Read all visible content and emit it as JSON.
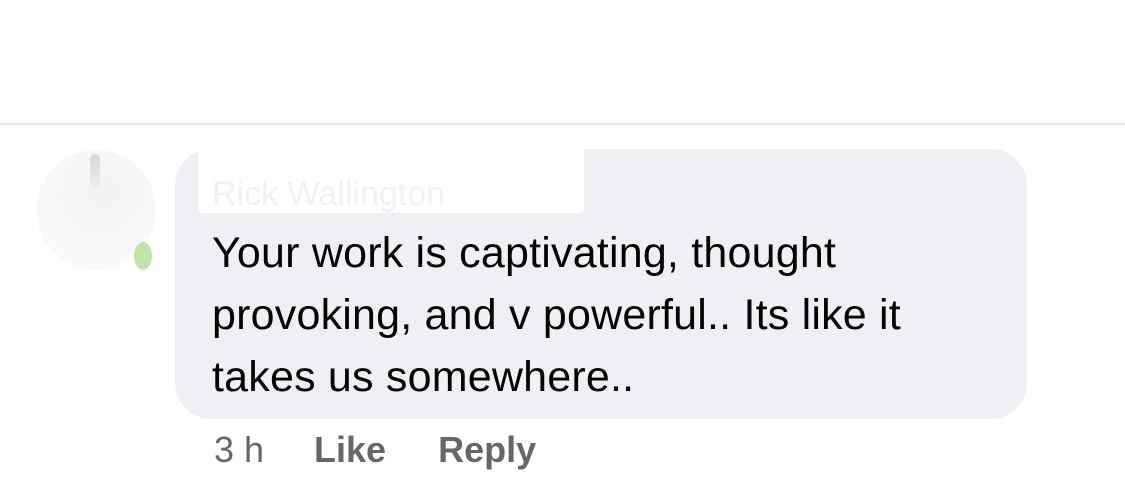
{
  "comment": {
    "author": "Rick Wallington",
    "lines": [
      "Your work is captivating, thought",
      "provoking, and v powerful.. Its like it",
      "takes us somewhere.."
    ],
    "timestamp": "3 h",
    "like_label": "Like",
    "reply_label": "Reply"
  },
  "colors": {
    "bubble": "#eff0f3",
    "text": "#050505",
    "secondary_text": "#65676b",
    "divider": "#e6e7ea",
    "online_indicator": "#bfe3a9"
  }
}
